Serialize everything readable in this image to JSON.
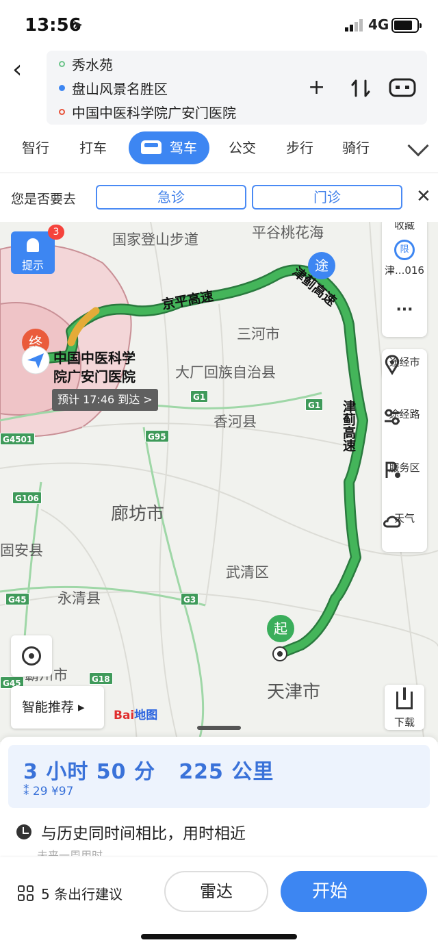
{
  "status": {
    "time": "13:56",
    "network": "4G"
  },
  "route": {
    "start": "秀水苑",
    "via": "盘山风景名胜区",
    "end": "中国中医科学院广安门医院",
    "colors": {
      "start": "#6cc48a",
      "via": "#3d86f2",
      "end": "#e8523a"
    }
  },
  "tabs": [
    "智行",
    "打车",
    "驾车",
    "公交",
    "步行",
    "骑行"
  ],
  "active_tab": "驾车",
  "suggest": {
    "question": "您是否要去",
    "options": [
      "急诊",
      "门诊"
    ]
  },
  "map": {
    "labels": {
      "trail": "国家登山步道",
      "pinggu": "平谷桃花海",
      "sanhe": "三河市",
      "dachang": "大厂回族自治县",
      "xianghe": "香河县",
      "langfang": "廊坊市",
      "guan": "固安县",
      "yongqing": "永清县",
      "wuqing": "武清区",
      "tianjin": "天津市",
      "bazhou": "霸州市"
    },
    "highways": [
      "G1",
      "G1",
      "G95",
      "G4501",
      "G106",
      "G45",
      "G3",
      "G18",
      "G45"
    ],
    "road_labels": {
      "jingping": "京平高速",
      "jinji_top": "津蓟高速",
      "jinji": "津蓟高速"
    },
    "alert": {
      "label": "提示",
      "badge": "3"
    },
    "right_panel_top": {
      "fav": "收藏",
      "restrict_icon": "限",
      "restrict": "津...016",
      "more": "···"
    },
    "right_panel": [
      "途经市",
      "途经路",
      "服务区",
      "天气"
    ],
    "destination": {
      "pin": "终",
      "name": "中国中医科学院广安门医院",
      "eta": "预计 17:46 到达 >"
    },
    "via_pin": "途",
    "start_pin": "起",
    "smart_recommend": "智能推荐 ▸",
    "logo_left": "Bai",
    "logo_right": "地图",
    "download": "下载"
  },
  "summary": {
    "duration": "3 小时 50 分",
    "distance": "225 公里",
    "detail": "29 ¥97",
    "history": "与历史同时间相比，用时相近",
    "history_sub": "未来一周用时"
  },
  "bottom": {
    "suggestions": "5 条出行建议",
    "radar": "雷达",
    "start": "开始"
  }
}
